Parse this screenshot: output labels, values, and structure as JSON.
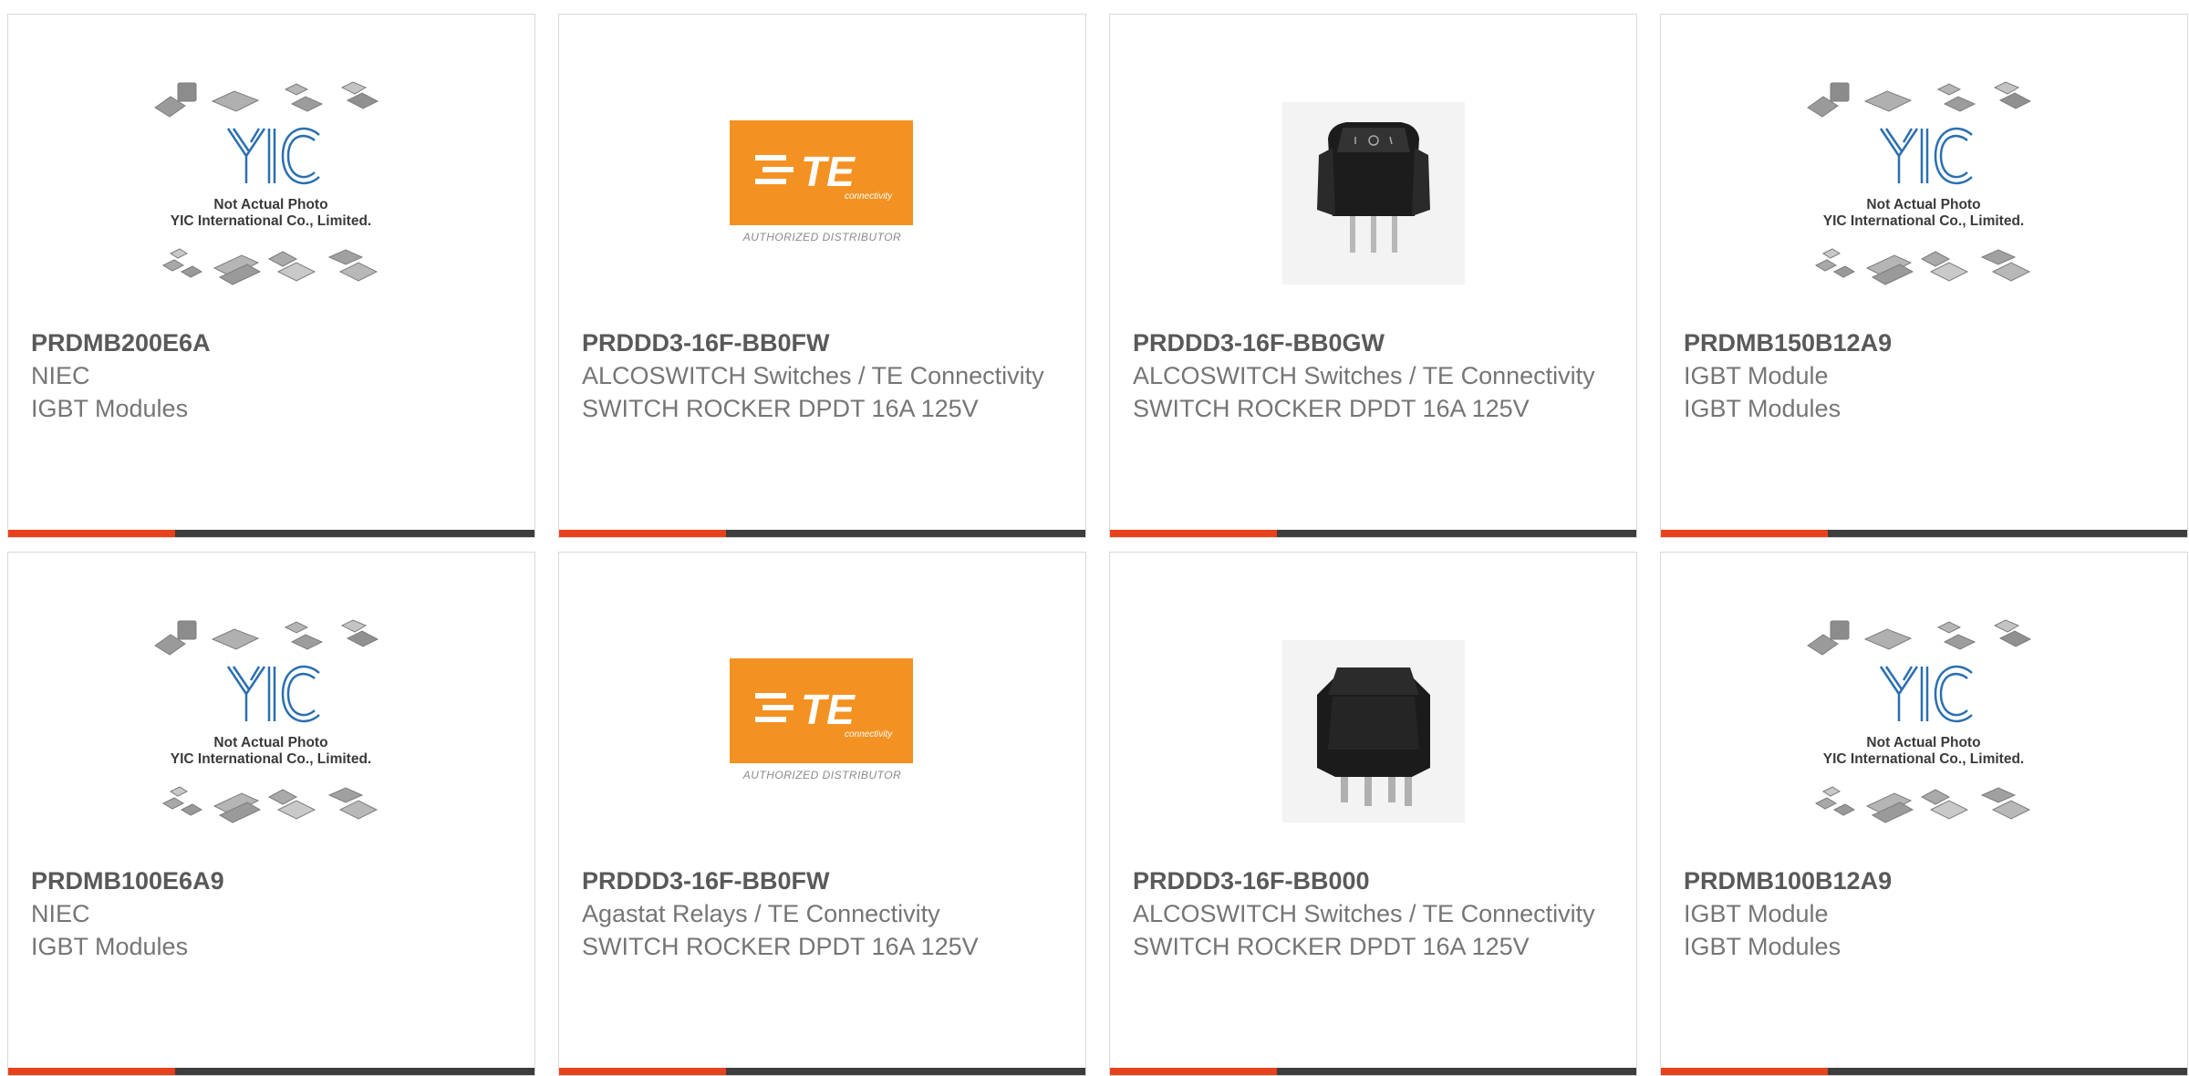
{
  "products": [
    {
      "part_number": "PRDMB200E6A",
      "lines": [
        "NIEC",
        "IGBT Modules"
      ],
      "image": "yic-placeholder",
      "accent_color": "#e8411d"
    },
    {
      "part_number": "PRDDD3-16F-BB0FW",
      "lines": [
        "ALCOSWITCH Switches / TE Connectivity",
        "SWITCH ROCKER DPDT 16A 125V"
      ],
      "image": "te-authorized-distributor",
      "accent_color": "#e8411d"
    },
    {
      "part_number": "PRDDD3-16F-BB0GW",
      "lines": [
        "ALCOSWITCH Switches / TE Connectivity",
        "SWITCH ROCKER DPDT 16A 125V"
      ],
      "image": "rocker-switch-photo",
      "accent_color": "#e8411d"
    },
    {
      "part_number": "PRDMB150B12A9",
      "lines": [
        "IGBT Module",
        "IGBT Modules"
      ],
      "image": "yic-placeholder",
      "accent_color": "#e8411d"
    },
    {
      "part_number": "PRDMB100E6A9",
      "lines": [
        "NIEC",
        "IGBT Modules"
      ],
      "image": "yic-placeholder",
      "accent_color": "#e8411d"
    },
    {
      "part_number": "PRDDD3-16F-BB0FW",
      "lines": [
        "Agastat Relays / TE Connectivity",
        "SWITCH ROCKER DPDT 16A 125V"
      ],
      "image": "te-authorized-distributor",
      "accent_color": "#e8411d"
    },
    {
      "part_number": "PRDDD3-16F-BB000",
      "lines": [
        "ALCOSWITCH Switches / TE Connectivity",
        "SWITCH ROCKER DPDT 16A 125V"
      ],
      "image": "rocker-switch-photo-square",
      "accent_color": "#e8411d"
    },
    {
      "part_number": "PRDMB100B12A9",
      "lines": [
        "IGBT Module",
        "IGBT Modules"
      ],
      "image": "yic-placeholder",
      "accent_color": "#e8411d"
    }
  ],
  "placeholder": {
    "caption_line1": "Not Actual Photo",
    "caption_line2": "YIC International Co., Limited.",
    "logo_text": "YIC"
  },
  "te_badge": {
    "logo_text": "TE",
    "tagline": "connectivity",
    "caption": "AUTHORIZED DISTRIBUTOR"
  },
  "colors": {
    "accent": "#e8411d",
    "bar": "#3d3d3d",
    "te_orange": "#f39222",
    "yic_blue": "#2a6fb0"
  }
}
